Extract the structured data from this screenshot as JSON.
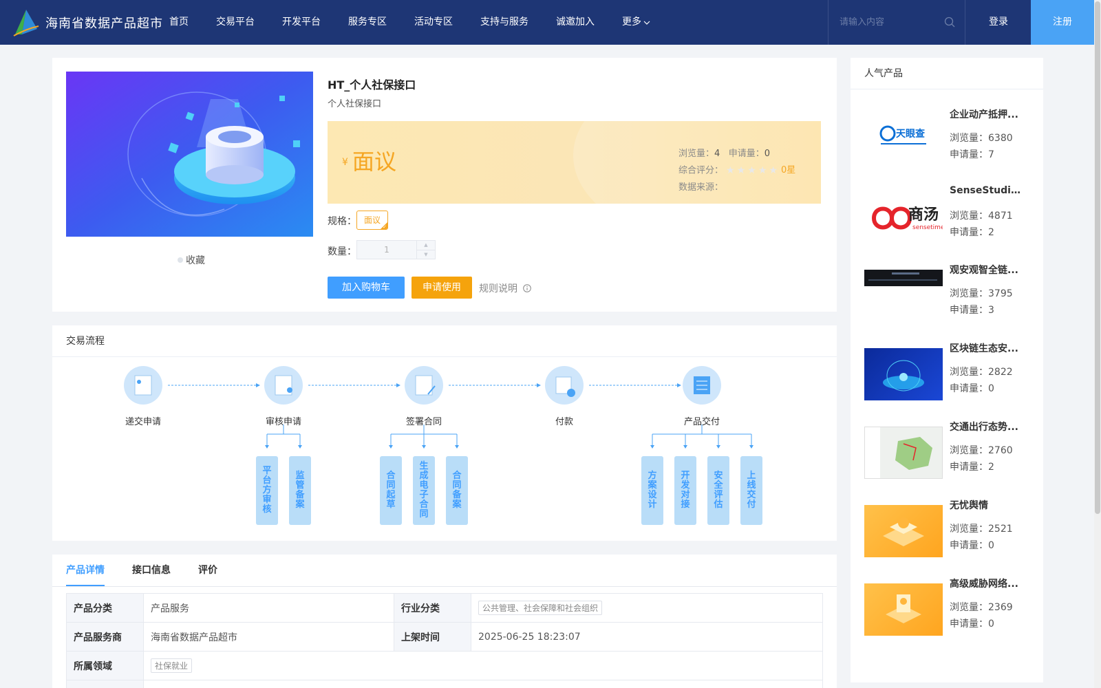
{
  "header": {
    "site_title": "海南省数据产品超市",
    "nav": [
      "首页",
      "交易平台",
      "开发平台",
      "服务专区",
      "活动专区",
      "支持与服务",
      "诚邀加入",
      "更多"
    ],
    "search_placeholder": "请输入内容",
    "login": "登录",
    "register": "注册"
  },
  "product": {
    "title": "HT_个人社保接口",
    "subtitle": "个人社保接口",
    "currency_symbol": "¥",
    "price": "面议",
    "views_label": "浏览量：",
    "views": "4",
    "applies_label": "申请量：",
    "applies": "0",
    "rating_label": "综合评分：",
    "rating": "0星",
    "source_label": "数据来源：",
    "favorite": "收藏",
    "spec_label": "规格：",
    "spec_value": "面议",
    "qty_label": "数量：",
    "qty_value": "1",
    "cart_btn": "加入购物车",
    "apply_btn": "申请使用",
    "rules": "规则说明"
  },
  "flow": {
    "title": "交易流程",
    "steps": [
      "递交申请",
      "审核申请",
      "签署合同",
      "付款",
      "产品交付"
    ],
    "sub": {
      "review": [
        "平台方审核",
        "监管备案"
      ],
      "contract": [
        "合同起草",
        "生成电子合同",
        "合同备案"
      ],
      "delivery": [
        "方案设计",
        "开发对接",
        "安全评估",
        "上线交付"
      ]
    }
  },
  "details": {
    "tabs": [
      "产品详情",
      "接口信息",
      "评价"
    ],
    "rows": {
      "category_label": "产品分类",
      "category": "产品服务",
      "industry_label": "行业分类",
      "industry": "公共管理、社会保障和社会组织",
      "provider_label": "产品服务商",
      "provider": "海南省数据产品超市",
      "listed_label": "上架时间",
      "listed": "2025-06-25 18:23:07",
      "domain_label": "所属领域",
      "domain": "社保就业"
    }
  },
  "popular": {
    "title": "人气产品",
    "views_label": "浏览量：",
    "applies_label": "申请量：",
    "items": [
      {
        "name": "企业动产抵押...",
        "views": "6380",
        "applies": "7",
        "thumb_text": "天眼查"
      },
      {
        "name": "SenseStudio...",
        "views": "4871",
        "applies": "2",
        "thumb_text": "商汤",
        "thumb_sub": "sensetime"
      },
      {
        "name": "观安观智全链...",
        "views": "3795",
        "applies": "3"
      },
      {
        "name": "区块链生态安...",
        "views": "2822",
        "applies": "0"
      },
      {
        "name": "交通出行态势...",
        "views": "2760",
        "applies": "2"
      },
      {
        "name": "无忧舆情",
        "views": "2521",
        "applies": "0"
      },
      {
        "name": "高级威胁网络...",
        "views": "2369",
        "applies": "0"
      }
    ]
  }
}
